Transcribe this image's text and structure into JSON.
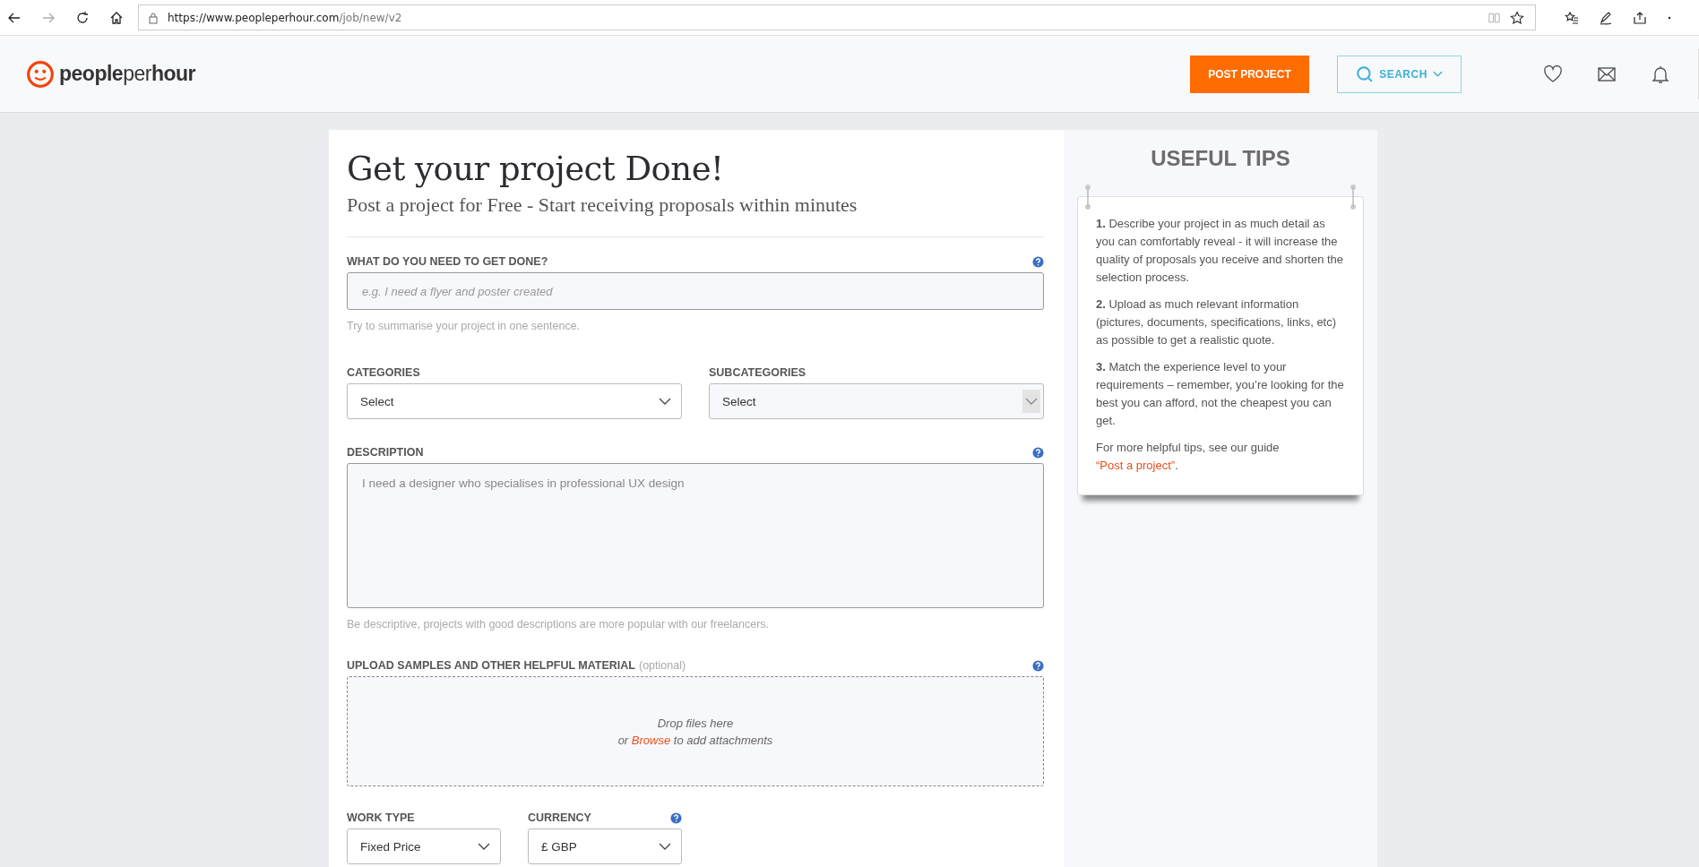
{
  "browser": {
    "url_host": "https://www.peopleperhour.com",
    "url_path": "/job/new/v2",
    "forward_disabled": true
  },
  "header": {
    "logo": "**people**per**hour**",
    "post_button": "POST PROJECT",
    "search_button": "SEARCH"
  },
  "form": {
    "title": "Get your project Done!",
    "subtitle": "Post a project for Free - Start receiving proposals within minutes",
    "what": {
      "label": "WHAT DO YOU NEED TO GET DONE?",
      "placeholder": "e.g. I need a flyer and poster created",
      "hint": "Try to summarise your project in one sentence."
    },
    "selects": [
      {
        "label": "CATEGORIES",
        "value": "Select",
        "disabled": false
      },
      {
        "label": "SUBCATEGORIES",
        "value": "Select",
        "disabled": true
      }
    ],
    "description": {
      "label": "DESCRIPTION",
      "placeholder": "I need a designer who specialises in professional UX design",
      "hint": "Be descriptive, projects with good descriptions are more popular with our freelancers."
    },
    "upload": {
      "label": "UPLOAD SAMPLES AND OTHER HELPFUL MATERIAL",
      "optional": "(optional)",
      "drop_text": "Drop files here",
      "or_text": "or",
      "browse": "Browse",
      "after_text": "to add attachments"
    },
    "bottom_selects": [
      {
        "label": "WORK TYPE",
        "value": "Fixed Price",
        "help": false
      },
      {
        "label": "CURRENCY",
        "value": "£ GBP",
        "help": true
      }
    ]
  },
  "tips": {
    "title": "USEFUL TIPS",
    "items": [
      "**1.** Describe your project in as much detail as you can comfortably reveal - it will increase the quality of proposals you receive and shorten the selection process.",
      "**2.** Upload as much relevant information (pictures, documents, specifications, links, etc) as possible to get a realistic quote.",
      "**3.** Match the experience level to your requirements – remember, you’re looking for the best you can afford, not the cheapest you can get."
    ],
    "more_text": "For more helpful tips, see our guide",
    "more_link": "“Post a project”",
    "more_end": "."
  }
}
